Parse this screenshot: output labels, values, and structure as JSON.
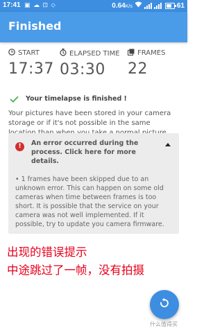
{
  "status_bar": {
    "time": "17:41",
    "speed": "0.64",
    "speed_unit": "K/s",
    "battery": "61"
  },
  "app_bar": {
    "title": "Finished"
  },
  "stats": {
    "start": {
      "label": "START",
      "value": "17:37",
      "icon": "clock-icon"
    },
    "elapsed": {
      "label": "ELAPSED TIME",
      "value": "03:30",
      "icon": "stopwatch-icon"
    },
    "frames": {
      "label": "FRAMES",
      "value": "22",
      "icon": "frames-icon"
    }
  },
  "success": {
    "message": "Your timelapse is finished !",
    "icon": "check-icon",
    "color": "#4caf50"
  },
  "info_text": "Your pictures have been stored in your camera storage or if it's not possible in the same location than when you take a normal picture.",
  "error": {
    "title": "An error occurred during the process. Click here for more details.",
    "details": "• 1 frames have been skipped due to an unknown error. This can happen on some old cameras when time between frames is too short. It is possible that the service on your camera was not well implemented. If it possible, try to update you camera firmware.",
    "icon": "error-icon",
    "color": "#d32f2f"
  },
  "annotations": [
    "出现的错误提示",
    "中途跳过了一帧，没有拍摄"
  ],
  "fab": {
    "icon": "replay-icon"
  },
  "watermark": "什么值得买",
  "colors": {
    "app_bar": "#4a9be8",
    "status_bar": "#3d8ee0",
    "accent": "#3d8ee0",
    "annotation": "#e8001c"
  }
}
